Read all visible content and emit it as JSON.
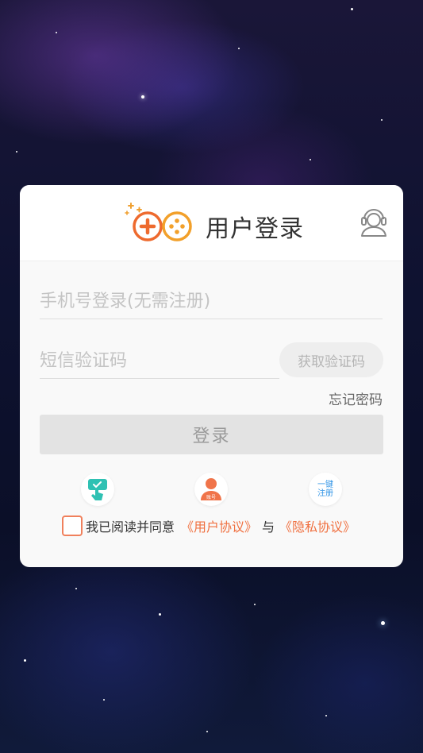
{
  "header": {
    "title": "用户登录",
    "logo_icon": "gamepad-logo-icon",
    "support_icon": "customer-service-icon"
  },
  "form": {
    "phone_placeholder": "手机号登录(无需注册)",
    "code_placeholder": "短信验证码",
    "get_code_label": "获取验证码",
    "forgot_password_label": "忘记密码",
    "login_label": "登录"
  },
  "login_methods": [
    {
      "icon": "phone-verify-icon"
    },
    {
      "icon": "account-login-icon",
      "label": "账号"
    },
    {
      "icon": "one-click-register-icon",
      "line1": "一键",
      "line2": "注册"
    }
  ],
  "agreement": {
    "prefix": "我已阅读并同意",
    "user_agreement": "《用户协议》",
    "conjunction": "与",
    "privacy_policy": "《隐私协议》"
  },
  "colors": {
    "accent": "#f07040",
    "card_bg": "#f9f9f9",
    "button_disabled": "#e3e3e3"
  }
}
